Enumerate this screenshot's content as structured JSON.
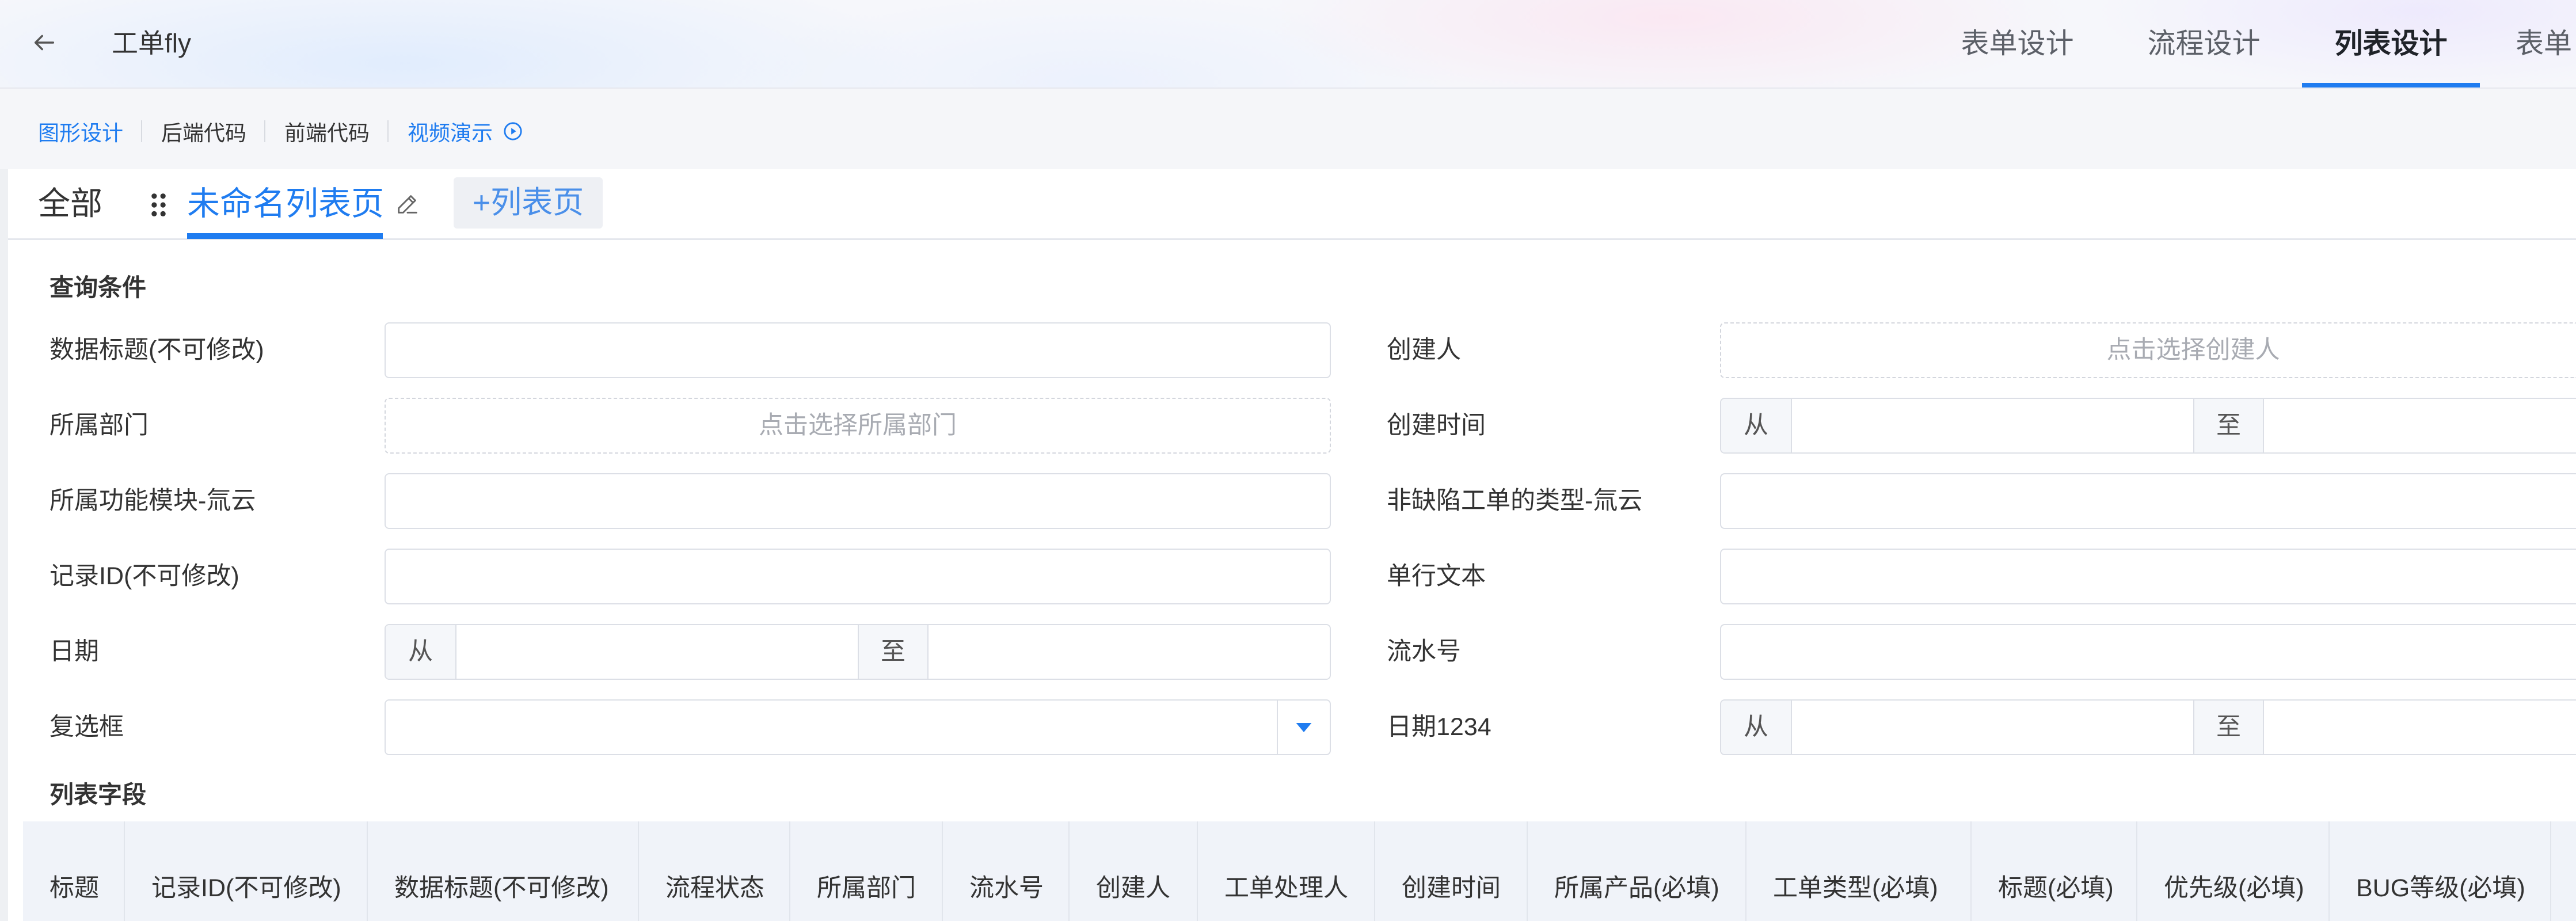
{
  "header": {
    "back_icon": "arrow-left-icon",
    "title": "工单fly",
    "tabs": [
      {
        "label": "表单设计",
        "active": false
      },
      {
        "label": "流程设计",
        "active": false
      },
      {
        "label": "列表设计",
        "active": true
      },
      {
        "label": "表单",
        "active": false
      }
    ]
  },
  "subnav": {
    "items": [
      {
        "label": "图形设计",
        "active": true
      },
      {
        "label": "后端代码",
        "active": false
      },
      {
        "label": "前端代码",
        "active": false
      },
      {
        "label": "视频演示",
        "active": false,
        "icon": "play-circle-icon"
      }
    ]
  },
  "list_tabs": {
    "all_label": "全部",
    "drag_icon": "drag-handle-icon",
    "current_label": "未命名列表页",
    "edit_icon": "pencil-icon",
    "add_label": "+列表页"
  },
  "query": {
    "title": "查询条件",
    "left_fields": [
      {
        "label": "数据标题(不可修改)",
        "value": ""
      },
      {
        "label": "所属部门",
        "placeholder": "点击选择所属部门"
      },
      {
        "label": "所属功能模块-氚云",
        "value": ""
      },
      {
        "label": "记录ID(不可修改)",
        "value": ""
      },
      {
        "label": "日期",
        "from_label": "从",
        "to_label": "至",
        "from_value": "",
        "to_value": ""
      },
      {
        "label": "复选框",
        "value": "",
        "icon": "caret-down-icon"
      }
    ],
    "right_fields": [
      {
        "label": "创建人",
        "placeholder": "点击选择创建人"
      },
      {
        "label": "创建时间",
        "from_label": "从",
        "to_label": "至",
        "from_value": "",
        "to_value": ""
      },
      {
        "label": "非缺陷工单的类型-氚云",
        "value": ""
      },
      {
        "label": "单行文本",
        "value": ""
      },
      {
        "label": "流水号",
        "value": ""
      },
      {
        "label": "日期1234",
        "from_label": "从",
        "to_label": "至",
        "from_value": "",
        "to_value": ""
      }
    ]
  },
  "list_fields": {
    "title": "列表字段",
    "columns": [
      "标题",
      "记录ID(不可修改)",
      "数据标题(不可修改)",
      "流程状态",
      "所属部门",
      "流水号",
      "创建人",
      "工单处理人",
      "创建时间",
      "所属产品(必填)",
      "工单类型(必填)",
      "标题(必填)",
      "优先级(必填)",
      "BUG等级(必填)"
    ]
  },
  "colors": {
    "accent": "#1f7cf0",
    "text": "#333333",
    "placeholder": "#a8abb2",
    "border": "#dcdfe6",
    "table_header_bg": "#f0f3f9"
  }
}
